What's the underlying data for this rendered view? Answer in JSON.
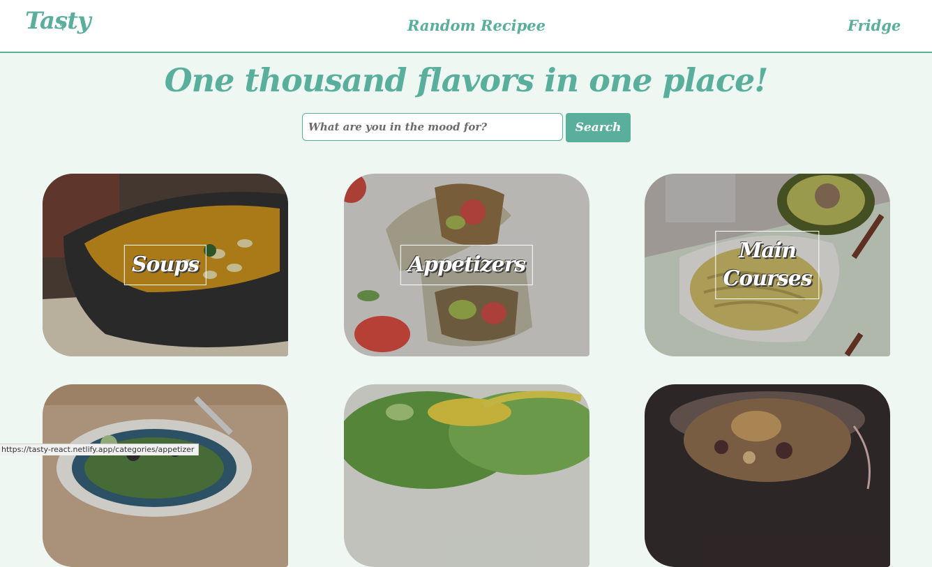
{
  "header": {
    "logo": "Tasty",
    "nav": {
      "random": "Random Recipee",
      "fridge": "Fridge"
    }
  },
  "hero": {
    "title": "One thousand flavors in one place!",
    "search_placeholder": "What are you in the mood for?",
    "search_button": "Search"
  },
  "categories": [
    {
      "label": "Soups",
      "image": "soup-bowl"
    },
    {
      "label": "Appetizers",
      "image": "wraps"
    },
    {
      "label": "Main\nCourses",
      "image": "pasta"
    },
    {
      "label": "",
      "image": "salad-bowl"
    },
    {
      "label": "",
      "image": "green-salad"
    },
    {
      "label": "",
      "image": "dessert-jar"
    }
  ],
  "status_url": "https://tasty-react.netlify.app/categories/appetizer",
  "colors": {
    "accent": "#5aaf9c",
    "background": "#eef7f2",
    "header": "#ffffff"
  }
}
